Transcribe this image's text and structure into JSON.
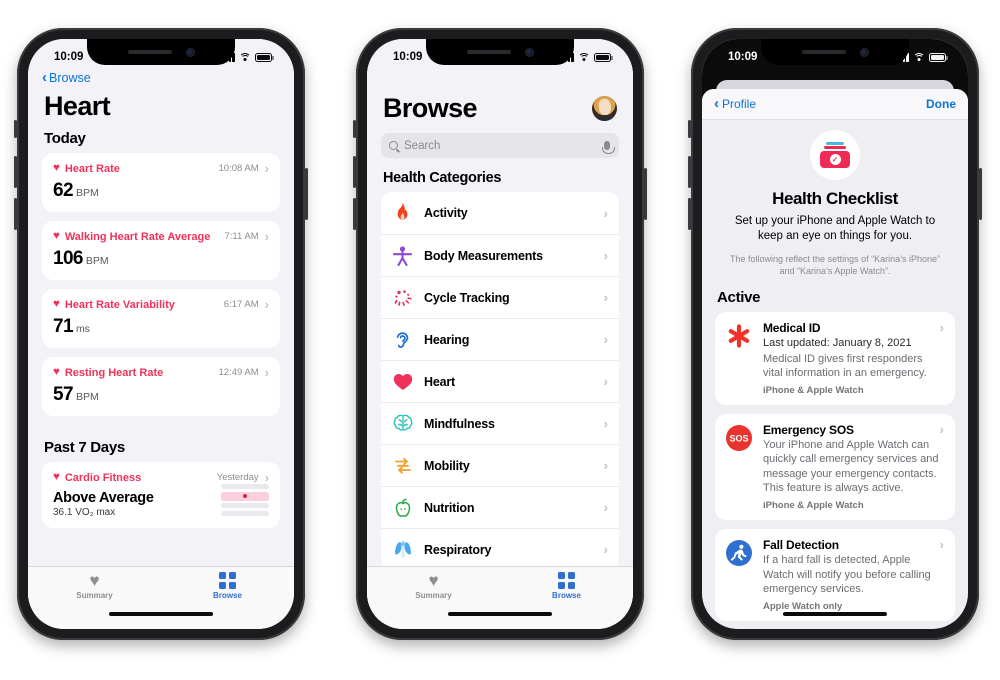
{
  "status_bar": {
    "time": "10:09",
    "signal_icon": "cellular-bars-icon",
    "wifi_icon": "wifi-icon",
    "battery_icon": "battery-icon"
  },
  "phone1": {
    "nav": {
      "back_label": "Browse",
      "back_icon": "chevron-left-icon"
    },
    "title": "Heart",
    "sections": [
      {
        "heading": "Today",
        "cards": [
          {
            "label": "Heart Rate",
            "icon": "heart-icon",
            "time": "10:08 AM",
            "value": "62",
            "unit": "BPM"
          },
          {
            "label": "Walking Heart Rate Average",
            "icon": "heart-icon",
            "time": "7:11 AM",
            "value": "106",
            "unit": "BPM"
          },
          {
            "label": "Heart Rate Variability",
            "icon": "heart-icon",
            "time": "6:17 AM",
            "value": "71",
            "unit": "ms"
          },
          {
            "label": "Resting Heart Rate",
            "icon": "heart-icon",
            "time": "12:49 AM",
            "value": "57",
            "unit": "BPM"
          }
        ]
      }
    ],
    "past7": {
      "heading": "Past 7 Days",
      "card": {
        "label": "Cardio Fitness",
        "icon": "heart-icon",
        "time": "Yesterday",
        "value": "Above Average",
        "sub": "36.1 VO₂ max"
      }
    },
    "tabbar": [
      {
        "label": "Summary",
        "icon": "heart-icon",
        "active": false
      },
      {
        "label": "Browse",
        "icon": "grid-icon",
        "active": true
      }
    ]
  },
  "phone2": {
    "title": "Browse",
    "avatar": "profile-avatar",
    "search": {
      "placeholder": "Search",
      "icon": "search-icon",
      "mic_icon": "microphone-icon"
    },
    "categories_heading": "Health Categories",
    "categories": [
      {
        "label": "Activity",
        "icon": "flame-icon",
        "color": "#f0441f"
      },
      {
        "label": "Body Measurements",
        "icon": "body-icon",
        "color": "#8e49d8"
      },
      {
        "label": "Cycle Tracking",
        "icon": "cycle-icon",
        "color": "#e8345c"
      },
      {
        "label": "Hearing",
        "icon": "ear-icon",
        "color": "#1f6fd0"
      },
      {
        "label": "Heart",
        "icon": "heart-icon",
        "color": "#f0325a"
      },
      {
        "label": "Mindfulness",
        "icon": "brain-icon",
        "color": "#2ec4bd"
      },
      {
        "label": "Mobility",
        "icon": "mobility-icon",
        "color": "#f0a02a"
      },
      {
        "label": "Nutrition",
        "icon": "apple-icon",
        "color": "#2ca84a"
      },
      {
        "label": "Respiratory",
        "icon": "lungs-icon",
        "color": "#3aa8ea"
      }
    ],
    "tabbar": [
      {
        "label": "Summary",
        "icon": "heart-icon",
        "active": false
      },
      {
        "label": "Browse",
        "icon": "grid-icon",
        "active": true
      }
    ]
  },
  "phone3": {
    "nav": {
      "back_label": "Profile",
      "back_icon": "chevron-left-icon",
      "done_label": "Done"
    },
    "hero_icon": "health-checklist-icon",
    "title": "Health Checklist",
    "subtitle": "Set up your iPhone and Apple Watch to keep an eye on things for you.",
    "fine_print": "The following reflect the settings of “Karina’s iPhone” and “Karina’s Apple Watch”.",
    "section_heading": "Active",
    "items": [
      {
        "name": "Medical ID",
        "icon": "medical-id-asterisk-icon",
        "updated": "Last updated: January 8, 2021",
        "description": "Medical ID gives first responders vital information in an emergency.",
        "devices": "iPhone & Apple Watch"
      },
      {
        "name": "Emergency SOS",
        "icon": "sos-icon",
        "updated": "",
        "description": "Your iPhone and Apple Watch can quickly call emergency services and message your emergency contacts. This feature is always active.",
        "devices": "iPhone & Apple Watch"
      },
      {
        "name": "Fall Detection",
        "icon": "fall-detection-icon",
        "updated": "",
        "description": "If a hard fall is detected, Apple Watch will notify you before calling emergency services.",
        "devices": "Apple Watch only"
      }
    ]
  },
  "colors": {
    "accent_blue": "#0a74d8",
    "heart_red": "#f0325a",
    "sos_red": "#e8342c",
    "fall_blue": "#2f6fd0",
    "bg_gray": "#f2f2f7"
  }
}
